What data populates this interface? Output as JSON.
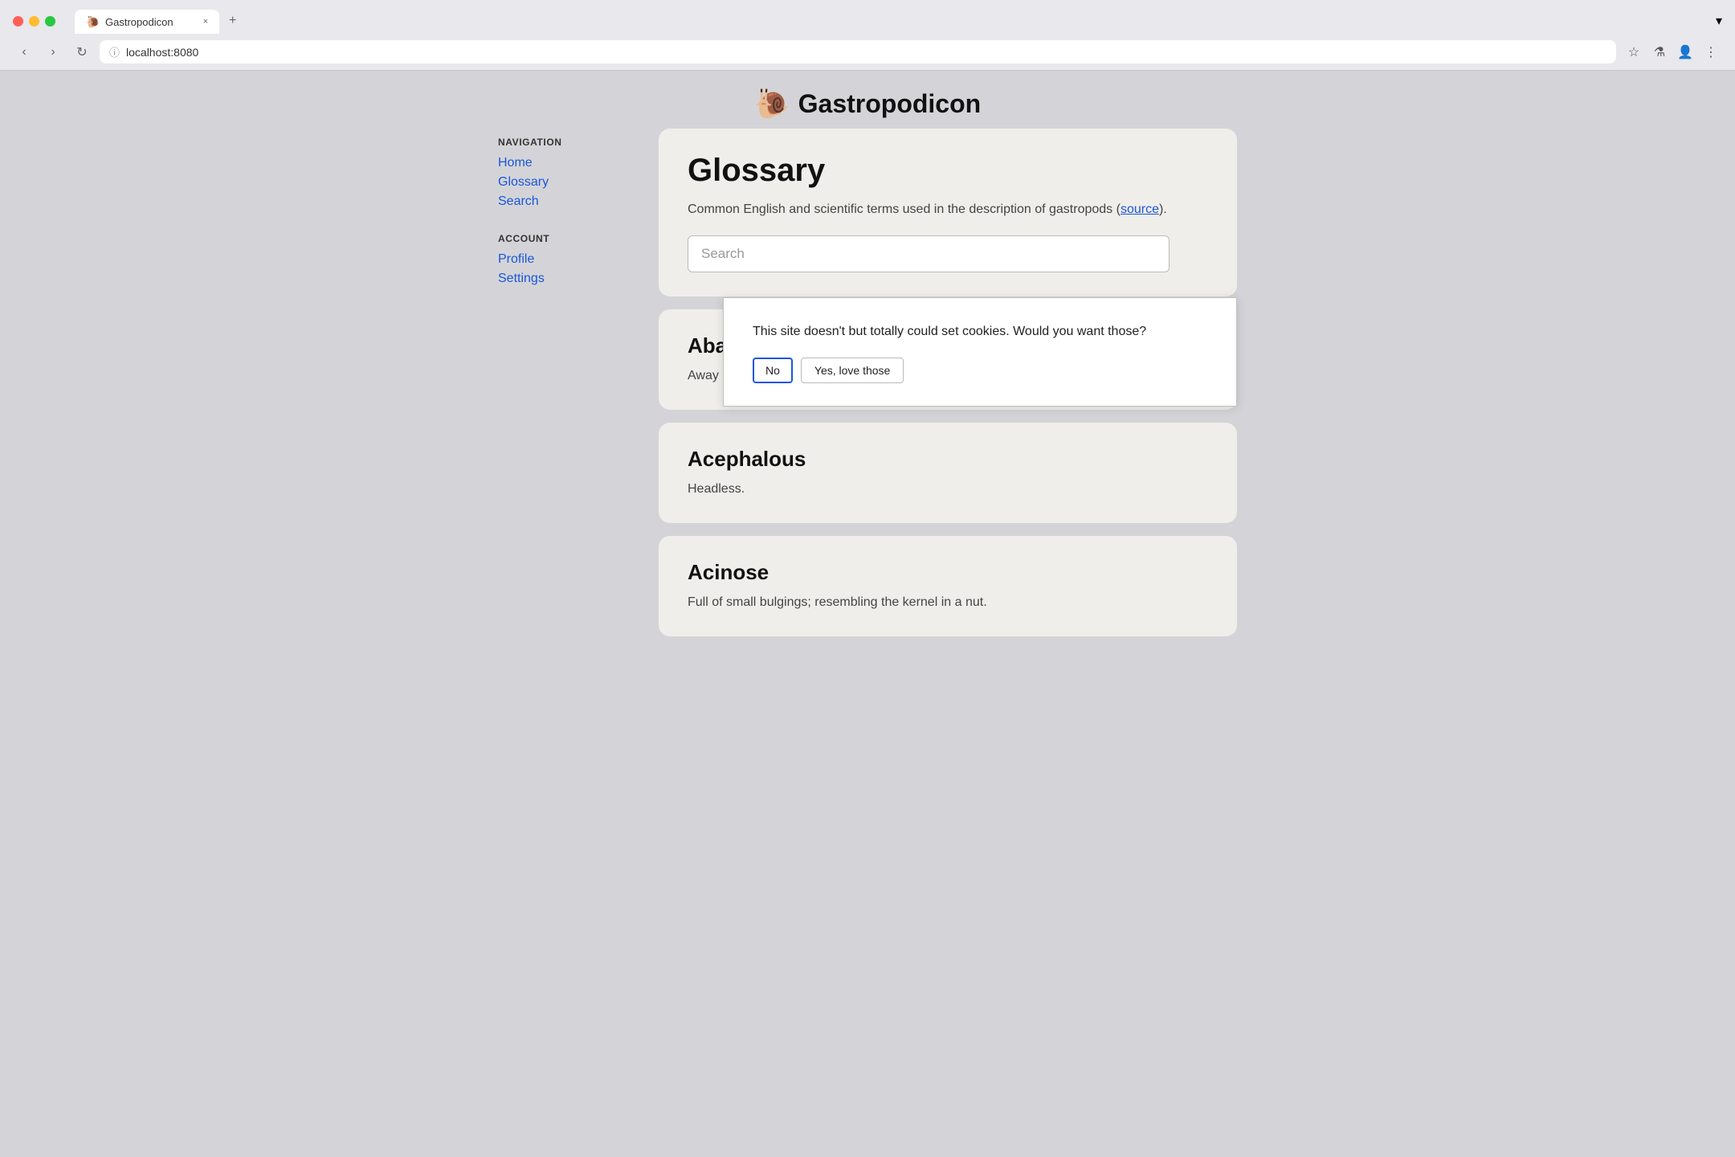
{
  "browser": {
    "traffic_lights": [
      "close",
      "minimize",
      "maximize"
    ],
    "tab_favicon": "🐌",
    "tab_title": "Gastropodicon",
    "tab_close_label": "×",
    "tab_new_label": "+",
    "tab_dropdown_label": "▾",
    "nav_back": "‹",
    "nav_forward": "›",
    "nav_reload": "↻",
    "address_icon": "ⓘ",
    "address_url": "localhost:8080",
    "toolbar_star": "☆",
    "toolbar_flask": "⚗",
    "toolbar_profile": "👤",
    "toolbar_menu": "⋮"
  },
  "site": {
    "logo_icon": "🐌",
    "title": "Gastropodicon"
  },
  "nav": {
    "navigation_label": "NAVIGATION",
    "links": [
      {
        "label": "Home",
        "href": "#"
      },
      {
        "label": "Glossary",
        "href": "#"
      },
      {
        "label": "Search",
        "href": "#"
      }
    ],
    "account_label": "ACCOUNT",
    "account_links": [
      {
        "label": "Profile",
        "href": "#"
      },
      {
        "label": "Settings",
        "href": "#"
      }
    ]
  },
  "glossary": {
    "title": "Glossary",
    "description_start": "Common English and scientific terms used in the description of gastropods (",
    "source_link_text": "source",
    "description_end": ").",
    "search_placeholder": "Search"
  },
  "cookie": {
    "message": "This site doesn't but totally could set cookies. Would you want those?",
    "btn_no": "No",
    "btn_yes": "Yes, love those"
  },
  "entries": [
    {
      "title": "Aba…",
      "description": "Away …"
    },
    {
      "title": "Acephalous",
      "description": "Headless."
    },
    {
      "title": "Acinose",
      "description": "Full of small bulgings; resembling the kernel in a nut."
    }
  ]
}
